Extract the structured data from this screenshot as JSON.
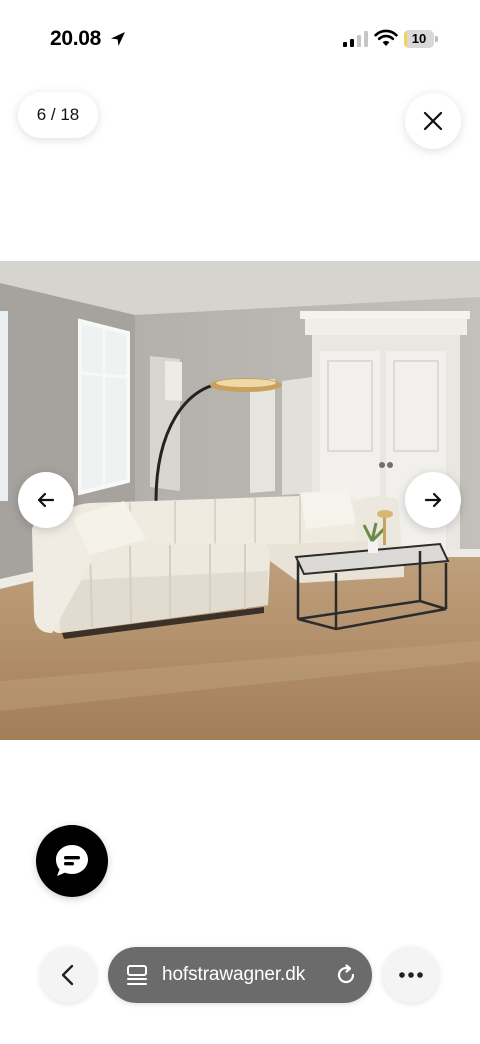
{
  "status_bar": {
    "time": "20.08",
    "battery_level": "10",
    "battery_fraction": 0.1,
    "battery_color": "#f2d649",
    "icons": [
      "location-arrow-icon",
      "signal-icon",
      "wifi-icon",
      "battery-icon"
    ]
  },
  "gallery": {
    "counter": "6 / 18",
    "current": 6,
    "total": 18,
    "close_icon": "close-icon",
    "prev_icon": "arrow-left-icon",
    "next_icon": "arrow-right-icon",
    "image_subject": "sofa-living-room-photo"
  },
  "chat": {
    "icon": "chat-bubble-icon"
  },
  "browser": {
    "url": "hofstrawagner.dk",
    "back_icon": "chevron-left-icon",
    "tabs_icon": "page-menu-icon",
    "reload_icon": "reload-icon",
    "more_icon": "more-dots-icon",
    "bar_color": "#6b6b6b"
  }
}
